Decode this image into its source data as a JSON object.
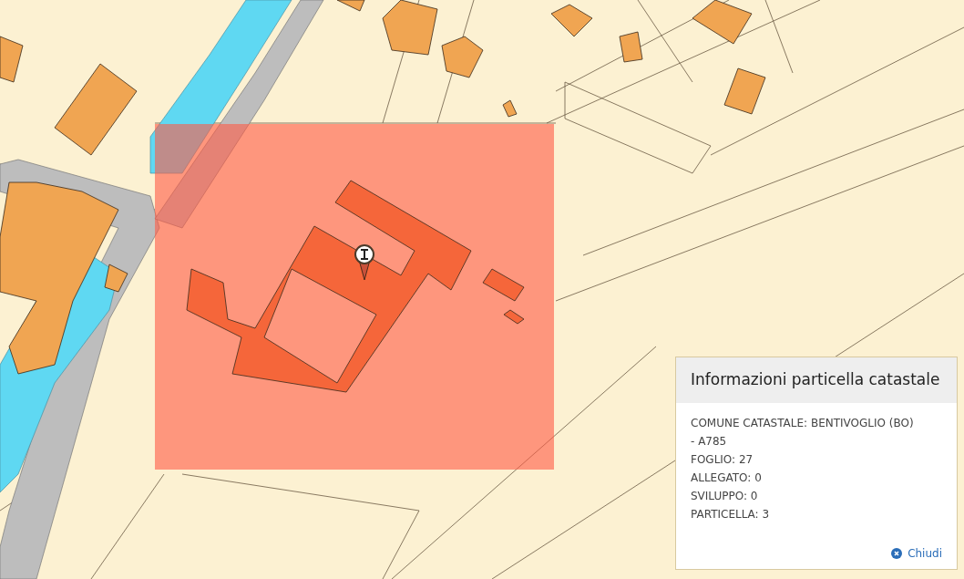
{
  "popup": {
    "title": "Informazioni particella catastale",
    "lines": [
      "COMUNE CATASTALE: BENTIVOGLIO (BO) - A785",
      "FOGLIO: 27",
      "ALLEGATO: 0",
      "SVILUPPO: 0",
      "PARTICELLA: 3"
    ],
    "close_label": "Chiudi"
  }
}
